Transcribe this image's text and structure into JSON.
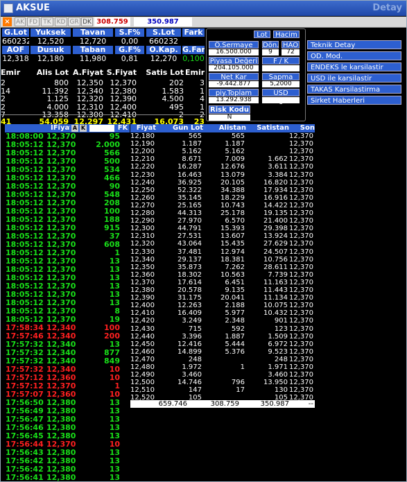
{
  "window": {
    "title": "AKSUE",
    "detail": "Detay"
  },
  "toolbar": {
    "tabs": [
      "AK",
      "FD",
      "TK",
      "KD",
      "GR",
      "DK"
    ],
    "n_label": "N",
    "input1": "308.759",
    "input2": "350.987"
  },
  "summary": {
    "row1_headers": [
      "G.Lot",
      "Yuksek",
      "Tavan",
      "S.F%",
      "S.Lot",
      "Fark"
    ],
    "row1_values": [
      "660232",
      "12,520",
      "12,720",
      "0,00",
      "660232",
      ""
    ],
    "row2_headers": [
      "AOF",
      "Dusuk",
      "Taban",
      "G.F%",
      "O.Kap.",
      "G.Fark"
    ],
    "row2_values": [
      "12,318",
      "12,180",
      "11,980",
      "0,81",
      "12,270",
      "0,100"
    ]
  },
  "panel": {
    "lot_btn": "Lot",
    "hacim_btn": "Hacim",
    "osermaye_label": "Ö.Sermaye",
    "osermaye_value": "16.500.000",
    "don_label": "Dön.",
    "don_value": "9",
    "hao_label": "HAO",
    "hao_value": "72",
    "piyasa_label": "Piyasa Değeri",
    "piyasa_value": "204.105.000",
    "fk_label": "F / K",
    "fk_value": "",
    "netkar_label": "Net Kar",
    "netkar_value": "-9.442.877",
    "sapma_label": "Sapma",
    "sapma_value": "5,2000",
    "piyt_label": "piy.Toplam Lot",
    "piyt_value": "13.292.938",
    "usd_label": "USD Değeri",
    "usd_value": "",
    "risk_label": "Risk Kodu",
    "risk_value": "N"
  },
  "side_menu": [
    "Teknik Detay",
    "OD. Mod.",
    "ENDEKS le karsilastir",
    "USD ile karsilastir",
    "TAKAS Karsilastirma",
    "Sirket Haberleri"
  ],
  "depth": {
    "headers": [
      "Emir",
      "Alis Lot",
      "A.Fiyat",
      "S.Fiyat",
      "Satis Lot",
      "Emir"
    ],
    "rows": [
      [
        "2",
        "800",
        "12,350",
        "12,370",
        "202",
        "3"
      ],
      [
        "14",
        "11.392",
        "12,340",
        "12,380",
        "1.583",
        "1"
      ],
      [
        "2",
        "1.125",
        "12,320",
        "12,390",
        "4.500",
        "4"
      ],
      [
        "2",
        "4.000",
        "12,310",
        "12,400",
        "495",
        "1"
      ],
      [
        "7",
        "13.358",
        "12,300",
        "12,410",
        "2",
        "2"
      ]
    ],
    "total": [
      "41",
      "54.059",
      "12,297",
      "12,431",
      "16.073",
      "23"
    ]
  },
  "trades": {
    "hdr_fiyat": "IFiyat",
    "hdr_a": "A",
    "hdr_k": "K",
    "hdr_fk": "FK",
    "rows": [
      {
        "t": "18:08:00",
        "p": "12,370",
        "l": "95",
        "c": "g"
      },
      {
        "t": "18:05:12",
        "p": "12,370",
        "l": "2.000",
        "c": "g"
      },
      {
        "t": "18:05:12",
        "p": "12,370",
        "l": "566",
        "c": "g"
      },
      {
        "t": "18:05:12",
        "p": "12,370",
        "l": "500",
        "c": "g"
      },
      {
        "t": "18:05:12",
        "p": "12,370",
        "l": "534",
        "c": "g"
      },
      {
        "t": "18:05:12",
        "p": "12,370",
        "l": "466",
        "c": "g"
      },
      {
        "t": "18:05:12",
        "p": "12,370",
        "l": "90",
        "c": "g"
      },
      {
        "t": "18:05:12",
        "p": "12,370",
        "l": "548",
        "c": "g"
      },
      {
        "t": "18:05:12",
        "p": "12,370",
        "l": "208",
        "c": "g"
      },
      {
        "t": "18:05:12",
        "p": "12,370",
        "l": "100",
        "c": "g"
      },
      {
        "t": "18:05:12",
        "p": "12,370",
        "l": "188",
        "c": "g"
      },
      {
        "t": "18:05:12",
        "p": "12,370",
        "l": "915",
        "c": "g"
      },
      {
        "t": "18:05:12",
        "p": "12,370",
        "l": "37",
        "c": "g"
      },
      {
        "t": "18:05:12",
        "p": "12,370",
        "l": "608",
        "c": "g"
      },
      {
        "t": "18:05:12",
        "p": "12,370",
        "l": "1",
        "c": "g"
      },
      {
        "t": "18:05:12",
        "p": "12,370",
        "l": "13",
        "c": "g"
      },
      {
        "t": "18:05:12",
        "p": "12,370",
        "l": "13",
        "c": "g"
      },
      {
        "t": "18:05:12",
        "p": "12,370",
        "l": "13",
        "c": "g"
      },
      {
        "t": "18:05:12",
        "p": "12,370",
        "l": "13",
        "c": "g"
      },
      {
        "t": "18:05:12",
        "p": "12,370",
        "l": "13",
        "c": "g"
      },
      {
        "t": "18:05:12",
        "p": "12,370",
        "l": "13",
        "c": "g"
      },
      {
        "t": "18:05:12",
        "p": "12,370",
        "l": "8",
        "c": "g"
      },
      {
        "t": "18:05:12",
        "p": "12,370",
        "l": "19",
        "c": "g"
      },
      {
        "t": "17:58:34",
        "p": "12,340",
        "l": "100",
        "c": "r"
      },
      {
        "t": "17:57:46",
        "p": "12,340",
        "l": "200",
        "c": "r"
      },
      {
        "t": "17:57:32",
        "p": "12,340",
        "l": "13",
        "c": "g"
      },
      {
        "t": "17:57:32",
        "p": "12,340",
        "l": "877",
        "c": "g"
      },
      {
        "t": "17:57:32",
        "p": "12,340",
        "l": "849",
        "c": "g"
      },
      {
        "t": "17:57:32",
        "p": "12,340",
        "l": "10",
        "c": "r"
      },
      {
        "t": "17:57:12",
        "p": "12,360",
        "l": "10",
        "c": "r"
      },
      {
        "t": "17:57:12",
        "p": "12,370",
        "l": "1",
        "c": "r"
      },
      {
        "t": "17:57:07",
        "p": "12,360",
        "l": "10",
        "c": "r"
      },
      {
        "t": "17:56:50",
        "p": "12,380",
        "l": "13",
        "c": "g"
      },
      {
        "t": "17:56:49",
        "p": "12,380",
        "l": "13",
        "c": "g"
      },
      {
        "t": "17:56:47",
        "p": "12,380",
        "l": "13",
        "c": "g"
      },
      {
        "t": "17:56:46",
        "p": "12,380",
        "l": "13",
        "c": "g"
      },
      {
        "t": "17:56:45",
        "p": "12,380",
        "l": "13",
        "c": "g"
      },
      {
        "t": "17:56:44",
        "p": "12,370",
        "l": "10",
        "c": "r"
      },
      {
        "t": "17:56:43",
        "p": "12,380",
        "l": "13",
        "c": "g"
      },
      {
        "t": "17:56:42",
        "p": "12,380",
        "l": "13",
        "c": "g"
      },
      {
        "t": "17:56:42",
        "p": "12,380",
        "l": "13",
        "c": "g"
      },
      {
        "t": "17:56:41",
        "p": "12,380",
        "l": "13",
        "c": "g"
      }
    ]
  },
  "book": {
    "headers": [
      "Fiyat",
      "Gun Lot",
      "Alistan",
      "Satistan",
      "Son"
    ],
    "rows": [
      [
        "12,180",
        "565",
        "565",
        "",
        "12,370"
      ],
      [
        "12,190",
        "1.187",
        "1.187",
        "",
        "12,370"
      ],
      [
        "12,200",
        "5.162",
        "5.162",
        "",
        "12,370"
      ],
      [
        "12,210",
        "8.671",
        "7.009",
        "1.662",
        "12,370"
      ],
      [
        "12,220",
        "16.287",
        "12.676",
        "3.611",
        "12,370"
      ],
      [
        "12,230",
        "16.463",
        "13.079",
        "3.384",
        "12,370"
      ],
      [
        "12,240",
        "36.925",
        "20.105",
        "16.820",
        "12,370"
      ],
      [
        "12,250",
        "52.322",
        "34.388",
        "17.934",
        "12,370"
      ],
      [
        "12,260",
        "35.145",
        "18.229",
        "16.916",
        "12,370"
      ],
      [
        "12,270",
        "25.165",
        "10.743",
        "14.422",
        "12,370"
      ],
      [
        "12,280",
        "44.313",
        "25.178",
        "19.135",
        "12,370"
      ],
      [
        "12,290",
        "27.970",
        "6.570",
        "21.400",
        "12,370"
      ],
      [
        "12,300",
        "44.791",
        "15.393",
        "29.398",
        "12,370"
      ],
      [
        "12,310",
        "27.531",
        "13.607",
        "13.924",
        "12,370"
      ],
      [
        "12,320",
        "43.064",
        "15.435",
        "27.629",
        "12,370"
      ],
      [
        "12,330",
        "37.481",
        "12.974",
        "24.507",
        "12,370"
      ],
      [
        "12,340",
        "29.137",
        "18.381",
        "10.756",
        "12,370"
      ],
      [
        "12,350",
        "35.873",
        "7.262",
        "28.611",
        "12,370"
      ],
      [
        "12,360",
        "18.302",
        "10.563",
        "7.739",
        "12,370"
      ],
      [
        "12,370",
        "17.614",
        "6.451",
        "11.163",
        "12,370"
      ],
      [
        "12,380",
        "20.578",
        "9.135",
        "11.443",
        "12,370"
      ],
      [
        "12,390",
        "31.175",
        "20.041",
        "11.134",
        "12,370"
      ],
      [
        "12,400",
        "12.263",
        "2.188",
        "10.075",
        "12,370"
      ],
      [
        "12,410",
        "16.409",
        "5.977",
        "10.432",
        "12,370"
      ],
      [
        "12,420",
        "3.249",
        "2.348",
        "901",
        "12,370"
      ],
      [
        "12,430",
        "715",
        "592",
        "123",
        "12,370"
      ],
      [
        "12,440",
        "3.396",
        "1.887",
        "1.509",
        "12,370"
      ],
      [
        "12,450",
        "12.416",
        "5.444",
        "6.972",
        "12,370"
      ],
      [
        "12,460",
        "14.899",
        "5.376",
        "9.523",
        "12,370"
      ],
      [
        "12,470",
        "248",
        "",
        "248",
        "12,370"
      ],
      [
        "12,480",
        "1.972",
        "1",
        "1.971",
        "12,370"
      ],
      [
        "12,490",
        "3.460",
        "",
        "3.460",
        "12,370"
      ],
      [
        "12,500",
        "14.746",
        "796",
        "13.950",
        "12,370"
      ],
      [
        "12,510",
        "147",
        "17",
        "130",
        "12,370"
      ],
      [
        "12,520",
        "105",
        "",
        "105",
        "12,370"
      ]
    ],
    "footer": [
      "659.746",
      "308.759",
      "350.987",
      "--"
    ]
  },
  "colors": {
    "header_blue": "#2d5fd0",
    "up": "#19e019",
    "down": "#ff2020",
    "yellow": "#ffff00"
  }
}
